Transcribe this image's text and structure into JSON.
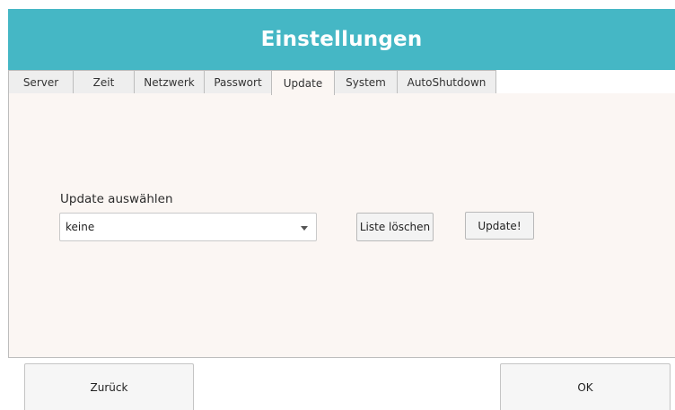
{
  "header": {
    "title": "Einstellungen"
  },
  "tabs": [
    {
      "label": "Server",
      "active": false
    },
    {
      "label": "Zeit",
      "active": false
    },
    {
      "label": "Netzwerk",
      "active": false
    },
    {
      "label": "Passwort",
      "active": false
    },
    {
      "label": "Update",
      "active": true
    },
    {
      "label": "System",
      "active": false
    },
    {
      "label": "AutoShutdown",
      "active": false
    }
  ],
  "update": {
    "label": "Update auswählen",
    "selected": "keine",
    "clear_button": "Liste löschen",
    "update_button": "Update!"
  },
  "footer": {
    "back_button": "Zurück",
    "ok_button": "OK"
  },
  "colors": {
    "header_bg": "#45b7c5",
    "content_bg": "#fbf6f3"
  }
}
